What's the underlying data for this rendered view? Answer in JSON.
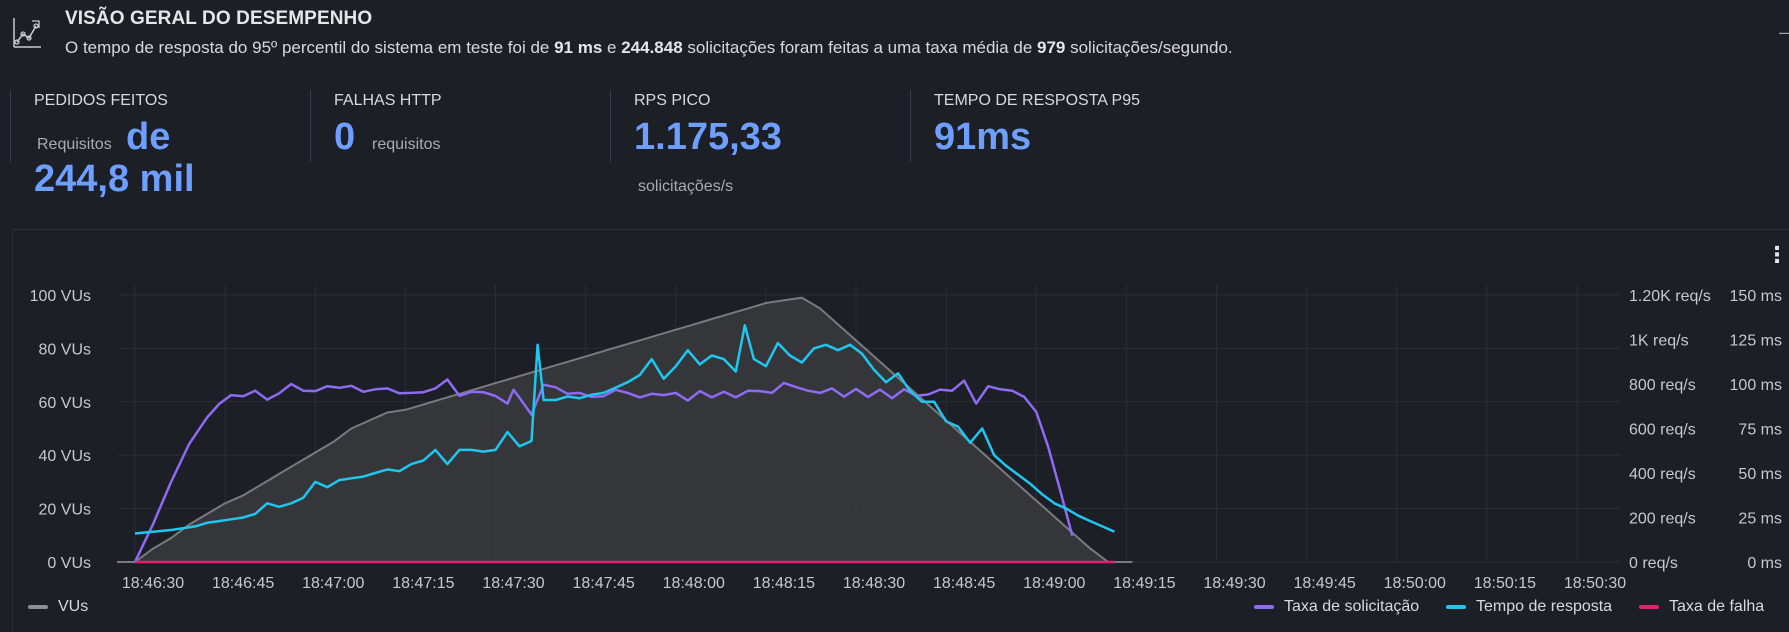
{
  "header": {
    "title": "VISÃO GERAL DO DESEMPENHO",
    "desc_1": "O tempo de resposta do 95º percentil do sistema em teste foi de ",
    "p95_value": "91 ms",
    "desc_2": " e ",
    "requests_value": "244.848",
    "desc_3": " solicitações foram feitas a uma taxa média de ",
    "avg_rate_value": "979",
    "desc_4": " solicitações/segundo.",
    "trailing": "–"
  },
  "stats": {
    "requests": {
      "label": "PEDIDOS FEITOS",
      "unit": "Requisitos",
      "value_prefix": "de",
      "value": "244,8 mil"
    },
    "failures": {
      "label": "FALHAS HTTP",
      "value": "0",
      "unit": "requisitos"
    },
    "peak_rps": {
      "label": "RPS PICO",
      "value": "1.175,33",
      "unit": "solicitações/s"
    },
    "p95": {
      "label": "TEMPO DE RESPOSTA P95",
      "value": "91ms"
    }
  },
  "panel": {
    "menu_icon": "kebab-menu-icon"
  },
  "colors": {
    "vus": "#8d8f94",
    "request_rate": "#8f6af5",
    "response_time": "#1ec6f0",
    "failure_rate": "#e0226e",
    "accent": "#6e9fff"
  },
  "chart_data": {
    "type": "line",
    "x_ticks": [
      "18:46:30",
      "18:46:45",
      "18:47:00",
      "18:47:15",
      "18:47:30",
      "18:47:45",
      "18:48:00",
      "18:48:15",
      "18:48:30",
      "18:48:45",
      "18:49:00",
      "18:49:15",
      "18:49:30",
      "18:49:45",
      "18:50:00",
      "18:50:15",
      "18:50:30"
    ],
    "x_range_seconds_from_first_tick": [
      -3,
      1.5
    ],
    "axes": {
      "vus": {
        "ticks": [
          "0 VUs",
          "20 VUs",
          "40 VUs",
          "60 VUs",
          "80 VUs",
          "100 VUs"
        ],
        "min": 0,
        "max": 100
      },
      "request_rate": {
        "ticks": [
          "0 req/s",
          "200 req/s",
          "400 req/s",
          "600 req/s",
          "800 req/s",
          "1K req/s",
          "1.20K req/s"
        ],
        "min": 0,
        "max": 1200
      },
      "response_time": {
        "ticks": [
          "0 ms",
          "25 ms",
          "50 ms",
          "75 ms",
          "100 ms",
          "125 ms",
          "150 ms"
        ],
        "min": 0,
        "max": 150
      }
    },
    "grid": true,
    "legend_position": "bottom",
    "series": [
      {
        "name": "VUs",
        "axis": "vus",
        "area": true,
        "points": [
          [
            -3,
            0
          ],
          [
            0,
            0
          ],
          [
            3,
            5
          ],
          [
            6,
            9
          ],
          [
            9,
            14
          ],
          [
            12,
            18
          ],
          [
            15,
            22
          ],
          [
            18,
            25
          ],
          [
            21,
            29
          ],
          [
            24,
            33
          ],
          [
            27,
            37
          ],
          [
            30,
            41
          ],
          [
            33,
            45
          ],
          [
            36,
            50
          ],
          [
            39,
            53
          ],
          [
            42,
            56
          ],
          [
            45,
            57
          ],
          [
            48,
            59
          ],
          [
            51,
            61
          ],
          [
            54,
            63
          ],
          [
            57,
            65
          ],
          [
            60,
            67
          ],
          [
            63,
            69
          ],
          [
            66,
            71
          ],
          [
            69,
            73
          ],
          [
            72,
            75
          ],
          [
            75,
            77
          ],
          [
            78,
            79
          ],
          [
            81,
            81
          ],
          [
            84,
            83
          ],
          [
            87,
            85
          ],
          [
            90,
            87
          ],
          [
            93,
            89
          ],
          [
            96,
            91
          ],
          [
            99,
            93
          ],
          [
            102,
            95
          ],
          [
            105,
            97
          ],
          [
            108,
            98
          ],
          [
            111,
            99
          ],
          [
            114,
            95
          ],
          [
            117,
            89
          ],
          [
            120,
            83
          ],
          [
            123,
            77
          ],
          [
            126,
            71
          ],
          [
            129,
            65
          ],
          [
            132,
            59
          ],
          [
            135,
            53
          ],
          [
            138,
            47
          ],
          [
            141,
            41
          ],
          [
            144,
            35
          ],
          [
            147,
            29
          ],
          [
            150,
            23
          ],
          [
            153,
            17
          ],
          [
            156,
            11
          ],
          [
            159,
            5
          ],
          [
            162,
            0
          ],
          [
            166,
            0
          ]
        ]
      },
      {
        "name": "Taxa de solicitação",
        "axis": "request_rate",
        "points": [
          [
            0,
            0
          ],
          [
            3,
            170
          ],
          [
            6,
            360
          ],
          [
            9,
            530
          ],
          [
            12,
            650
          ],
          [
            14,
            710
          ],
          [
            16,
            750
          ],
          [
            18,
            745
          ],
          [
            20,
            770
          ],
          [
            22,
            730
          ],
          [
            24,
            758
          ],
          [
            26,
            800
          ],
          [
            28,
            770
          ],
          [
            30,
            768
          ],
          [
            32,
            790
          ],
          [
            34,
            783
          ],
          [
            36,
            792
          ],
          [
            38,
            765
          ],
          [
            40,
            776
          ],
          [
            42,
            780
          ],
          [
            44,
            758
          ],
          [
            46,
            760
          ],
          [
            48,
            763
          ],
          [
            50,
            780
          ],
          [
            52,
            820
          ],
          [
            54,
            747
          ],
          [
            56,
            765
          ],
          [
            58,
            763
          ],
          [
            60,
            746
          ],
          [
            62,
            712
          ],
          [
            63,
            774
          ],
          [
            64,
            738
          ],
          [
            66,
            662
          ],
          [
            68,
            797
          ],
          [
            70,
            785
          ],
          [
            72,
            756
          ],
          [
            74,
            760
          ],
          [
            76,
            742
          ],
          [
            78,
            745
          ],
          [
            80,
            774
          ],
          [
            82,
            760
          ],
          [
            84,
            740
          ],
          [
            86,
            756
          ],
          [
            88,
            750
          ],
          [
            90,
            760
          ],
          [
            92,
            726
          ],
          [
            94,
            768
          ],
          [
            96,
            740
          ],
          [
            98,
            765
          ],
          [
            100,
            740
          ],
          [
            102,
            770
          ],
          [
            104,
            768
          ],
          [
            106,
            760
          ],
          [
            108,
            805
          ],
          [
            110,
            786
          ],
          [
            112,
            770
          ],
          [
            114,
            760
          ],
          [
            116,
            780
          ],
          [
            118,
            743
          ],
          [
            120,
            778
          ],
          [
            122,
            742
          ],
          [
            124,
            775
          ],
          [
            126,
            736
          ],
          [
            128,
            776
          ],
          [
            130,
            747
          ],
          [
            132,
            753
          ],
          [
            134,
            775
          ],
          [
            136,
            770
          ],
          [
            138,
            815
          ],
          [
            140,
            712
          ],
          [
            142,
            790
          ],
          [
            144,
            776
          ],
          [
            146,
            770
          ],
          [
            148,
            742
          ],
          [
            150,
            674
          ],
          [
            152,
            516
          ],
          [
            154,
            320
          ],
          [
            156,
            118
          ]
        ]
      },
      {
        "name": "Tempo de resposta",
        "axis": "response_time",
        "points": [
          [
            0,
            16
          ],
          [
            3,
            17
          ],
          [
            6,
            18
          ],
          [
            8,
            19
          ],
          [
            10,
            20
          ],
          [
            12,
            22
          ],
          [
            14,
            23
          ],
          [
            16,
            24
          ],
          [
            18,
            25
          ],
          [
            20,
            27
          ],
          [
            22,
            33
          ],
          [
            24,
            31
          ],
          [
            26,
            33
          ],
          [
            28,
            36
          ],
          [
            30,
            45
          ],
          [
            32,
            42
          ],
          [
            34,
            46
          ],
          [
            36,
            47
          ],
          [
            38,
            48
          ],
          [
            40,
            50
          ],
          [
            42,
            52
          ],
          [
            44,
            51
          ],
          [
            46,
            55
          ],
          [
            48,
            57
          ],
          [
            50,
            63
          ],
          [
            52,
            55
          ],
          [
            54,
            63
          ],
          [
            56,
            63
          ],
          [
            58,
            62
          ],
          [
            60,
            63
          ],
          [
            62,
            73
          ],
          [
            64,
            65
          ],
          [
            66,
            68
          ],
          [
            67,
            122
          ],
          [
            68,
            91
          ],
          [
            70,
            91
          ],
          [
            72,
            93
          ],
          [
            74,
            92
          ],
          [
            76,
            94
          ],
          [
            78,
            95
          ],
          [
            80,
            98
          ],
          [
            82,
            101
          ],
          [
            84,
            105
          ],
          [
            86,
            114
          ],
          [
            88,
            103
          ],
          [
            90,
            110
          ],
          [
            92,
            119
          ],
          [
            94,
            111
          ],
          [
            96,
            116
          ],
          [
            98,
            114
          ],
          [
            100,
            107
          ],
          [
            101.5,
            133
          ],
          [
            103,
            114
          ],
          [
            105,
            110
          ],
          [
            107,
            123
          ],
          [
            109,
            116
          ],
          [
            111,
            112
          ],
          [
            113,
            120
          ],
          [
            115,
            122
          ],
          [
            117,
            119
          ],
          [
            119,
            122
          ],
          [
            121,
            117
          ],
          [
            123,
            108
          ],
          [
            125,
            101
          ],
          [
            127,
            106
          ],
          [
            129,
            96
          ],
          [
            131,
            90
          ],
          [
            133,
            90
          ],
          [
            135,
            79
          ],
          [
            137,
            76
          ],
          [
            139,
            67
          ],
          [
            141,
            75
          ],
          [
            143,
            60
          ],
          [
            145,
            54
          ],
          [
            147,
            49
          ],
          [
            149,
            44
          ],
          [
            151,
            38
          ],
          [
            153,
            33
          ],
          [
            155,
            30
          ],
          [
            157,
            26
          ],
          [
            159,
            23
          ],
          [
            161,
            20
          ],
          [
            163,
            17
          ]
        ]
      },
      {
        "name": "Taxa de falha",
        "axis": "request_rate",
        "points": [
          [
            0,
            0
          ],
          [
            163,
            0
          ]
        ]
      }
    ],
    "legend": [
      "VUs",
      "Taxa de solicitação",
      "Tempo de resposta",
      "Taxa de falha"
    ]
  }
}
